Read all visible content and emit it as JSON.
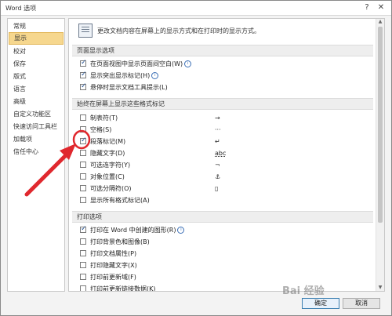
{
  "window": {
    "title": "Word 选项",
    "help": "?",
    "close": "✕"
  },
  "sidebar": {
    "items": [
      {
        "label": "常规"
      },
      {
        "label": "显示",
        "active": true
      },
      {
        "label": "校对"
      },
      {
        "label": "保存"
      },
      {
        "label": "版式"
      },
      {
        "label": "语言"
      },
      {
        "label": "高级"
      },
      {
        "label": "自定义功能区"
      },
      {
        "label": "快速访问工具栏"
      },
      {
        "label": "加载项"
      },
      {
        "label": "信任中心"
      }
    ]
  },
  "main": {
    "intro": "更改文档内容在屏幕上的显示方式和在打印时的显示方式。",
    "page_display": {
      "header": "页面显示选项",
      "options": [
        {
          "label": "在页面视图中显示页面间空白(W)",
          "checked": true,
          "info": true
        },
        {
          "label": "显示突出显示标记(H)",
          "checked": true,
          "info": true
        },
        {
          "label": "悬停时显示文档工具提示(L)",
          "checked": true,
          "info": false
        }
      ]
    },
    "formatting_marks": {
      "header": "始终在屏幕上显示这些格式标记",
      "options": [
        {
          "label": "制表符(T)",
          "checked": false,
          "symbol": "→"
        },
        {
          "label": "空格(S)",
          "checked": false,
          "symbol": "···"
        },
        {
          "label": "段落标记(M)",
          "checked": true,
          "symbol": "↵"
        },
        {
          "label": "隐藏文字(D)",
          "checked": false,
          "symbol": "abc"
        },
        {
          "label": "可选连字符(Y)",
          "checked": false,
          "symbol": "¬"
        },
        {
          "label": "对象位置(C)",
          "checked": false,
          "symbol": "⚓"
        },
        {
          "label": "可选分隔符(O)",
          "checked": false,
          "symbol": "▯"
        },
        {
          "label": "显示所有格式标记(A)",
          "checked": false,
          "symbol": ""
        }
      ]
    },
    "print": {
      "header": "打印选项",
      "options": [
        {
          "label": "打印在 Word 中创建的图形(R)",
          "checked": true,
          "info": true
        },
        {
          "label": "打印背景色和图像(B)",
          "checked": false,
          "info": false
        },
        {
          "label": "打印文档属性(P)",
          "checked": false,
          "info": false
        },
        {
          "label": "打印隐藏文字(X)",
          "checked": false,
          "info": false
        },
        {
          "label": "打印前更新域(F)",
          "checked": false,
          "info": false
        },
        {
          "label": "打印前更新链接数据(K)",
          "checked": false,
          "info": false
        }
      ]
    }
  },
  "footer": {
    "ok": "确定",
    "cancel": "取消"
  },
  "watermark": "Bai 经验",
  "colors": {
    "accent_arrow": "#e0282e",
    "nav_active": "#f6d78e"
  }
}
